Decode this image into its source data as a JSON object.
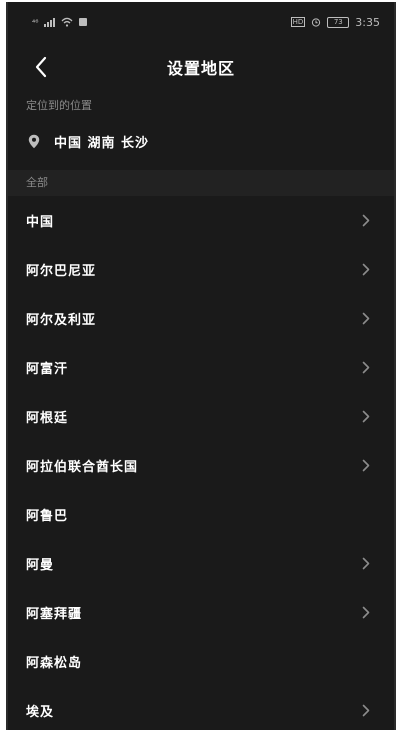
{
  "statusbar": {
    "left_text": "⁴⁶",
    "time": "3:35",
    "hd": "HD",
    "battery_text": "73"
  },
  "header": {
    "title": "设置地区"
  },
  "located": {
    "label": "定位到的位置",
    "location": "中国 湖南 长沙"
  },
  "all": {
    "label": "全部"
  },
  "regions": [
    {
      "name": "中国",
      "has_chevron": true
    },
    {
      "name": "阿尔巴尼亚",
      "has_chevron": true
    },
    {
      "name": "阿尔及利亚",
      "has_chevron": true
    },
    {
      "name": "阿富汗",
      "has_chevron": true
    },
    {
      "name": "阿根廷",
      "has_chevron": true
    },
    {
      "name": "阿拉伯联合酋长国",
      "has_chevron": true
    },
    {
      "name": "阿鲁巴",
      "has_chevron": false
    },
    {
      "name": "阿曼",
      "has_chevron": true
    },
    {
      "name": "阿塞拜疆",
      "has_chevron": true
    },
    {
      "name": "阿森松岛",
      "has_chevron": false
    },
    {
      "name": "埃及",
      "has_chevron": true
    }
  ],
  "colors": {
    "background": "#1a1a1a",
    "text": "#ffffff",
    "muted": "#8a8a8a",
    "chevron": "#8c8c8c"
  },
  "icons": {
    "back": "chevron-left-icon",
    "location": "location-pin-icon",
    "row": "chevron-right-icon"
  }
}
